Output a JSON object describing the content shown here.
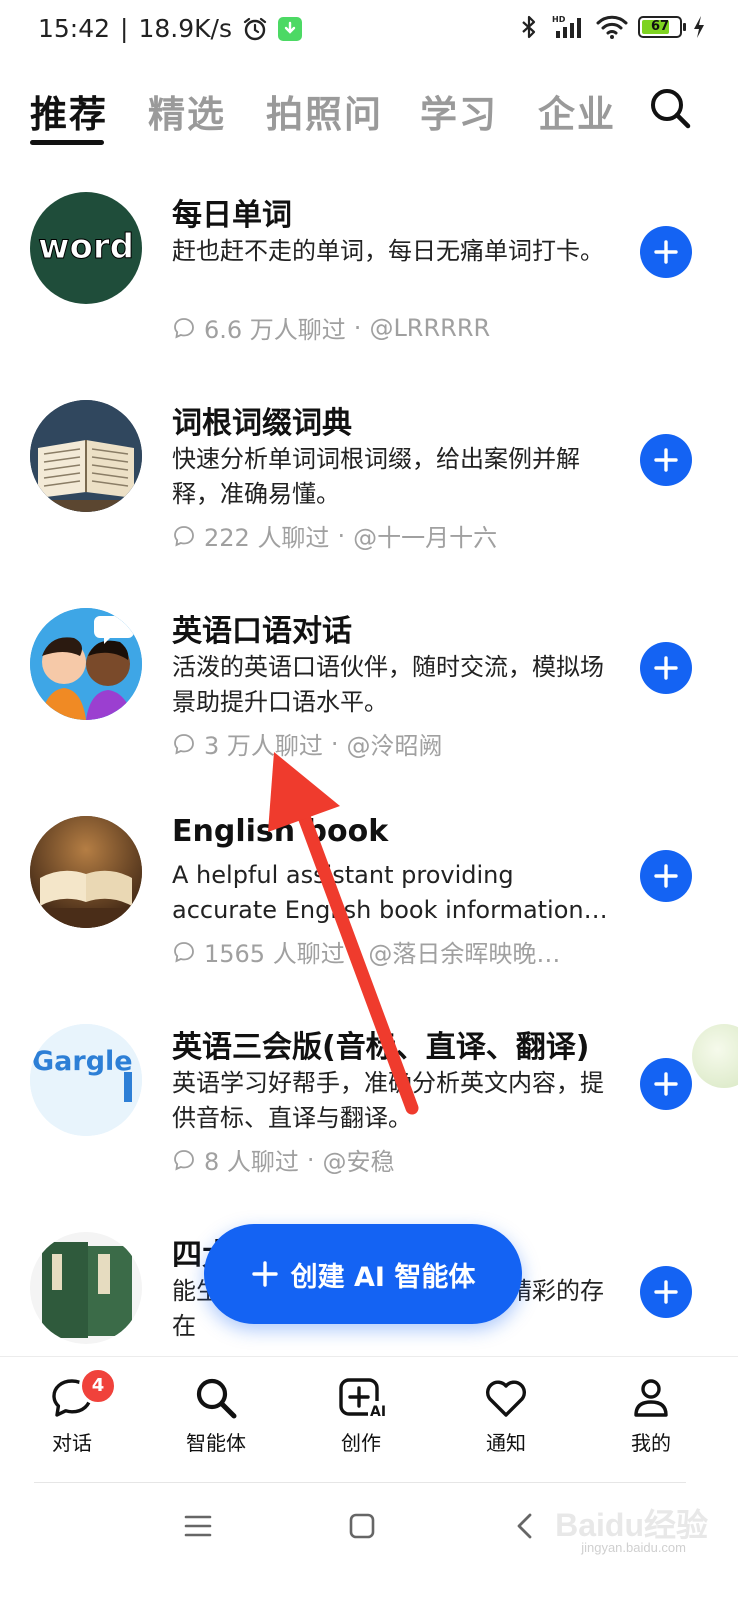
{
  "status_bar": {
    "time": "15:42",
    "network_speed": "18.9K/s",
    "battery_level": "67",
    "icons": [
      "alarm-icon",
      "download-badge-icon",
      "bluetooth-icon",
      "signal-hd-icon",
      "wifi-icon",
      "battery-icon",
      "charging-icon"
    ]
  },
  "tabs": [
    {
      "label": "推荐",
      "active": true
    },
    {
      "label": "精选",
      "active": false
    },
    {
      "label": "拍照问",
      "active": false
    },
    {
      "label": "学习",
      "active": false
    },
    {
      "label": "企业",
      "active": false
    }
  ],
  "agents": [
    {
      "title": "每日单词",
      "desc": "赶也赶不走的单词，每日无痛单词打卡。",
      "chats": "6.6 万人聊过",
      "author": "@LRRRRR",
      "avatar_text": "word"
    },
    {
      "title": "词根词缀词典",
      "desc": "快速分析单词词根词缀，给出案例并解释，准确易懂。",
      "chats": "222 人聊过",
      "author": "@十一月十六"
    },
    {
      "title": "英语口语对话",
      "desc": "活泼的英语口语伙伴，随时交流，模拟场景助提升口语水平。",
      "chats": "3 万人聊过",
      "author": "@泠昭阙"
    },
    {
      "title": "English book",
      "desc": "A helpful assistant providing accurate English book information…",
      "chats": "1565 人聊过",
      "author": "@落日余晖映晚…"
    },
    {
      "title": "英语三会版(音标、直译、翻译)",
      "desc": "英语学习好帮手，准确分析英文内容，提供音标、直译与翻译。",
      "chats": "8 人聊过",
      "author": "@安稳",
      "avatar_text": "Gargle and spit"
    },
    {
      "title": "四大名著(精彩内容)",
      "desc": "能生动讲述四大名著，领略其中精彩的存在",
      "chats": "",
      "author": ""
    }
  ],
  "create_button": {
    "label": "创建 AI 智能体"
  },
  "bottom_nav": [
    {
      "label": "对话",
      "icon": "chat-bubble-icon",
      "badge": "4"
    },
    {
      "label": "智能体",
      "icon": "search-agent-icon"
    },
    {
      "label": "创作",
      "icon": "create-ai-icon",
      "icon_text": "AI"
    },
    {
      "label": "通知",
      "icon": "heart-icon"
    },
    {
      "label": "我的",
      "icon": "person-icon"
    }
  ],
  "system_nav": [
    "menu-icon",
    "home-icon",
    "back-icon"
  ],
  "watermark": {
    "brand": "Baidu经验",
    "url": "jingyan.baidu.com"
  },
  "colors": {
    "accent": "#1463f3",
    "badge": "#f0423b",
    "annotation_arrow": "#ef3b2d",
    "muted": "#a0a0a0"
  }
}
